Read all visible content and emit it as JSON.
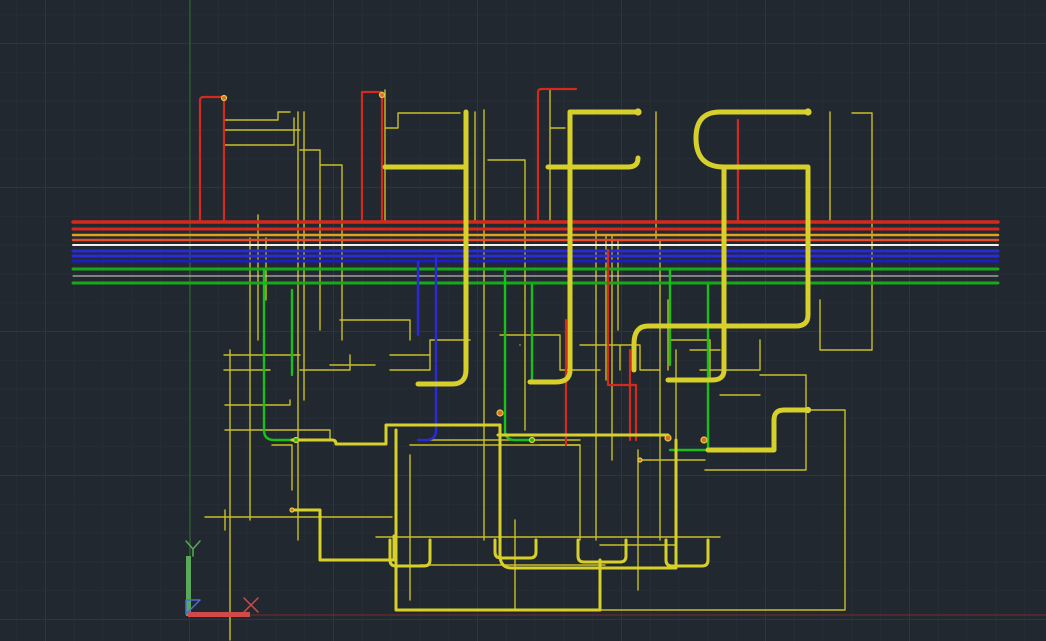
{
  "viewport": {
    "background": "#212830",
    "grid_major": "#2d353f",
    "grid_minor": "#262d36"
  },
  "ucs_icon": {
    "y_label": "Y",
    "y_color": "#5aa85a",
    "x_color": "#d04a4a",
    "origin_color": "#4a6fd0"
  },
  "drawing": {
    "main_pipe_colors": [
      "#d42a1e",
      "#e0a020",
      "#f2f2f2",
      "#2a2ad6",
      "#19a819"
    ],
    "riser_color": "#d8d02a",
    "supply_color": "#d42a1e",
    "return_color": "#19c019",
    "vent_color": "#2a2ad6"
  }
}
